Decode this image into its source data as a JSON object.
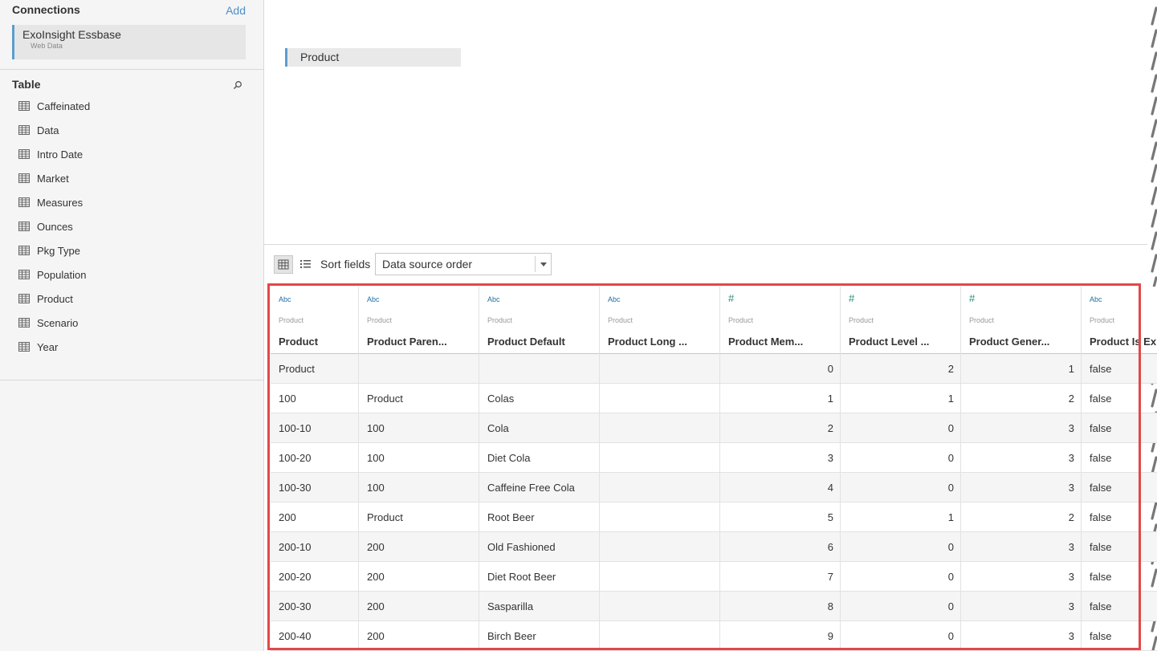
{
  "connections": {
    "title": "Connections",
    "add_label": "Add",
    "items": [
      {
        "name": "ExoInsight Essbase",
        "type": "Web Data"
      }
    ]
  },
  "tables": {
    "title": "Table",
    "items": [
      "Caffeinated",
      "Data",
      "Intro Date",
      "Market",
      "Measures",
      "Ounces",
      "Pkg Type",
      "Population",
      "Product",
      "Scenario",
      "Year"
    ]
  },
  "canvas": {
    "table_name": "Product"
  },
  "toolbar": {
    "sort_label": "Sort fields",
    "sort_value": "Data source order"
  },
  "grid": {
    "columns": [
      {
        "type": "Abc",
        "source": "Product",
        "name": "Product"
      },
      {
        "type": "Abc",
        "source": "Product",
        "name": "Product Paren..."
      },
      {
        "type": "Abc",
        "source": "Product",
        "name": "Product Default"
      },
      {
        "type": "Abc",
        "source": "Product",
        "name": "Product Long ..."
      },
      {
        "type": "#",
        "source": "Product",
        "name": "Product Mem..."
      },
      {
        "type": "#",
        "source": "Product",
        "name": "Product Level ..."
      },
      {
        "type": "#",
        "source": "Product",
        "name": "Product Gener..."
      },
      {
        "type": "Abc",
        "source": "Product",
        "name": "Product Is Exp"
      }
    ],
    "rows": [
      [
        "Product",
        "",
        "",
        "",
        "0",
        "2",
        "1",
        "false"
      ],
      [
        "100",
        "Product",
        "Colas",
        "",
        "1",
        "1",
        "2",
        "false"
      ],
      [
        "100-10",
        "100",
        "Cola",
        "",
        "2",
        "0",
        "3",
        "false"
      ],
      [
        "100-20",
        "100",
        "Diet Cola",
        "",
        "3",
        "0",
        "3",
        "false"
      ],
      [
        "100-30",
        "100",
        "Caffeine Free Cola",
        "",
        "4",
        "0",
        "3",
        "false"
      ],
      [
        "200",
        "Product",
        "Root Beer",
        "",
        "5",
        "1",
        "2",
        "false"
      ],
      [
        "200-10",
        "200",
        "Old Fashioned",
        "",
        "6",
        "0",
        "3",
        "false"
      ],
      [
        "200-20",
        "200",
        "Diet Root Beer",
        "",
        "7",
        "0",
        "3",
        "false"
      ],
      [
        "200-30",
        "200",
        "Sasparilla",
        "",
        "8",
        "0",
        "3",
        "false"
      ],
      [
        "200-40",
        "200",
        "Birch Beer",
        "",
        "9",
        "0",
        "3",
        "false"
      ]
    ]
  },
  "colors": {
    "accent": "#5b9dd0",
    "highlight": "#e24848",
    "type_text": "#1f6fa5",
    "type_number": "#2a8a7a"
  }
}
